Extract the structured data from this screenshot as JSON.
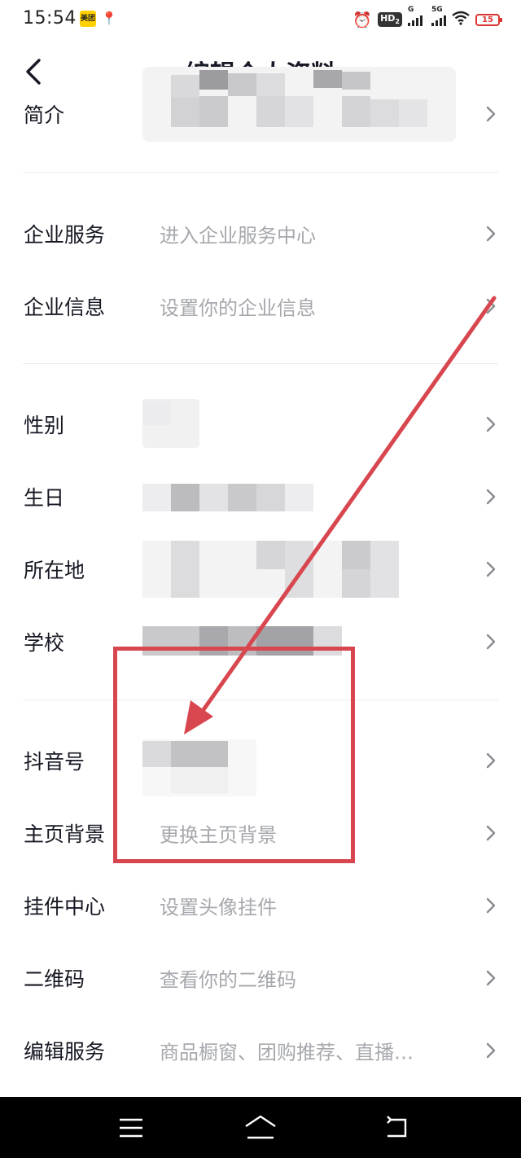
{
  "status_bar": {
    "time": "15:54",
    "meituan_badge": "美团",
    "map_badge": "📍",
    "alarm_icon": "alarm-icon",
    "hd_label": "HD",
    "hd_sub": "2",
    "net1": "G",
    "net2": "5G",
    "battery": "15"
  },
  "nav": {
    "title": "编辑个人资料",
    "back_icon": "chevron-left-icon"
  },
  "rows": [
    {
      "label": "简介",
      "value": ""
    },
    {
      "label": "企业服务",
      "value": "进入企业服务中心"
    },
    {
      "label": "企业信息",
      "value": "设置你的企业信息"
    },
    {
      "label": "性别",
      "value": ""
    },
    {
      "label": "生日",
      "value": ""
    },
    {
      "label": "所在地",
      "value": ""
    },
    {
      "label": "学校",
      "value": ""
    },
    {
      "label": "抖音号",
      "value": ""
    },
    {
      "label": "主页背景",
      "value": "更换主页背景"
    },
    {
      "label": "挂件中心",
      "value": "设置头像挂件"
    },
    {
      "label": "二维码",
      "value": "查看你的二维码"
    },
    {
      "label": "编辑服务",
      "value": "商品橱窗、团购推荐、直播…"
    }
  ],
  "colors": {
    "annotation": "#d8474f",
    "label": "#161823",
    "hint": "#a6a8ad",
    "divider": "#ececee"
  },
  "system_nav": {
    "menu_icon": "menu-icon",
    "home_icon": "home-icon",
    "back_icon": "back-icon"
  }
}
